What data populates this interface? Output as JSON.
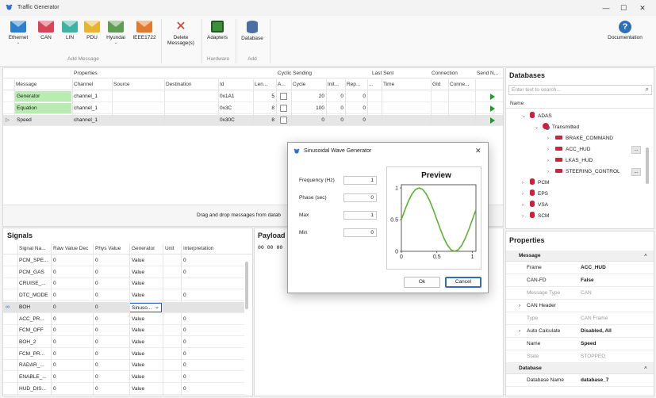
{
  "window": {
    "title": "Traffic Generator",
    "minimize": "—",
    "maximize": "☐",
    "close": "✕"
  },
  "ribbon": {
    "add_message": {
      "group_label": "Add Message",
      "buttons": [
        {
          "label": "Ethernet",
          "color": "#2f7fd1",
          "chev": "⌄"
        },
        {
          "label": "CAN",
          "color": "#d9445a",
          "chev": ""
        },
        {
          "label": "LIN",
          "color": "#3fb3a3",
          "chev": ""
        },
        {
          "label": "PDU",
          "color": "#e8b530",
          "chev": ""
        },
        {
          "label": "Hyundai",
          "color": "#5f9e52",
          "chev": "⌄"
        },
        {
          "label": "IEEE1722",
          "color": "#e07a2e",
          "chev": ""
        }
      ],
      "delete_label_1": "Delete",
      "delete_label_2": "Message(s)"
    },
    "hardware": {
      "group_label": "Hardware",
      "adapters_label": "Adapters"
    },
    "add": {
      "group_label": "Add",
      "database_label": "Database"
    },
    "documentation_label": "Documentation"
  },
  "messages_grid": {
    "group_headers": {
      "properties": "Properties",
      "cyclic": "Cyclic Sending",
      "last_sent": "Last Sent",
      "connection": "Connection",
      "send_now": "Send N..."
    },
    "columns": [
      "Message",
      "Channel",
      "Source",
      "Destination",
      "Id",
      "Len...",
      "A...",
      "Cycle",
      "Init...",
      "Rep...",
      "...",
      "Time",
      "GId",
      "Conne..."
    ],
    "rows": [
      {
        "message": "Generator",
        "channel": "channel_1",
        "id": "0x1A1",
        "len": "5",
        "cycle": "20",
        "init": "0",
        "rep": "0"
      },
      {
        "message": "Equation",
        "channel": "channel_1",
        "id": "0x3C",
        "len": "8",
        "cycle": "100",
        "init": "0",
        "rep": "0"
      },
      {
        "message": "Speed",
        "channel": "channel_1",
        "id": "0x30C",
        "len": "8",
        "cycle": "0",
        "init": "0",
        "rep": "0"
      }
    ],
    "selected_marker": "▷",
    "drag_hint": "Drag and drop messages from datab"
  },
  "signals": {
    "title": "Signals",
    "columns": [
      "Signal Na...",
      "Raw Value Dec",
      "Phys Value",
      "Generator",
      "Unit",
      "Interpretation"
    ],
    "rows": [
      {
        "name": "PCM_SPE...",
        "raw": "0",
        "phys": "0",
        "gen": "Value",
        "interp": "0"
      },
      {
        "name": "PCM_GAS",
        "raw": "0",
        "phys": "0",
        "gen": "Value",
        "interp": "0"
      },
      {
        "name": "CRUISE_...",
        "raw": "0",
        "phys": "0",
        "gen": "Value",
        "interp": ""
      },
      {
        "name": "DTC_MODE",
        "raw": "0",
        "phys": "0",
        "gen": "Value",
        "interp": "0"
      },
      {
        "name": "BOH",
        "raw": "0",
        "phys": "0",
        "gen": "Sinuso...",
        "interp": ""
      },
      {
        "name": "ACC_PR...",
        "raw": "0",
        "phys": "0",
        "gen": "Value",
        "interp": "0"
      },
      {
        "name": "FCM_OFF",
        "raw": "0",
        "phys": "0",
        "gen": "Value",
        "interp": "0"
      },
      {
        "name": "BOH_2",
        "raw": "0",
        "phys": "0",
        "gen": "Value",
        "interp": "0"
      },
      {
        "name": "FCM_PR...",
        "raw": "0",
        "phys": "0",
        "gen": "Value",
        "interp": "0"
      },
      {
        "name": "RADAR_...",
        "raw": "0",
        "phys": "0",
        "gen": "Value",
        "interp": "0"
      },
      {
        "name": "ENABLE_...",
        "raw": "0",
        "phys": "0",
        "gen": "Value",
        "interp": "0"
      },
      {
        "name": "HUD_DIS...",
        "raw": "0",
        "phys": "0",
        "gen": "Value",
        "interp": "0"
      }
    ]
  },
  "payload": {
    "title": "Payload",
    "bytes": "00  00  00"
  },
  "databases": {
    "title": "Databases",
    "search_placeholder": "Enter text to search...",
    "name_header": "Name",
    "tree": [
      {
        "label": "ADAS",
        "tri": "⌄",
        "kind": "db"
      },
      {
        "label": "Transmitted",
        "tri": "⌄",
        "kind": "tx"
      },
      {
        "label": "BRAKE_COMMAND",
        "tri": "›",
        "kind": "msg"
      },
      {
        "label": "ACC_HUD",
        "tri": "›",
        "kind": "msg"
      },
      {
        "label": "LKAS_HUD",
        "tri": "›",
        "kind": "msg"
      },
      {
        "label": "STEERING_CONTROL",
        "tri": "›",
        "kind": "msg"
      },
      {
        "label": "PCM",
        "tri": "›",
        "kind": "db"
      },
      {
        "label": "EPS",
        "tri": "›",
        "kind": "db"
      },
      {
        "label": "VSA",
        "tri": "›",
        "kind": "db"
      },
      {
        "label": "SCM",
        "tri": "›",
        "kind": "db"
      }
    ],
    "more": "..."
  },
  "properties": {
    "title": "Properties",
    "message_section": "Message",
    "frame_k": "Frame",
    "frame_v": "ACC_HUD",
    "canfd_k": "CAN-FD",
    "canfd_v": "False",
    "msgtype_k": "Message Type",
    "msgtype_v": "CAN",
    "canheader_k": "CAN Header",
    "type_k": "Type",
    "type_v": "CAN Frame",
    "autocalc_k": "Auto Calculate",
    "autocalc_v": "Disabled, All",
    "name_k": "Name",
    "name_v": "Speed",
    "state_k": "State",
    "state_v": "STOPPED",
    "database_section": "Database",
    "dbname_k": "Database Name",
    "dbname_v": "database_7"
  },
  "dialog": {
    "title": "Sinusoidal Wave Generator",
    "close": "✕",
    "fields": [
      {
        "label": "Frequency (Hz)",
        "value": "1"
      },
      {
        "label": "Phase (sec)",
        "value": "0"
      },
      {
        "label": "Max",
        "value": "1"
      },
      {
        "label": "Min",
        "value": "0"
      }
    ],
    "ok_label": "Ok",
    "cancel_label": "Cancel"
  },
  "chart_data": {
    "type": "line",
    "title": "Preview",
    "xlim": [
      0,
      1.05
    ],
    "ylim": [
      0,
      1.05
    ],
    "xticks": [
      "0",
      "0.5",
      "1"
    ],
    "yticks": [
      "0",
      "0.5",
      "1"
    ],
    "xtick_values": [
      0,
      0.5,
      1
    ],
    "ytick_values": [
      0,
      0.5,
      1
    ],
    "series": [
      {
        "color": "#5ab42e",
        "x": [
          0,
          0.05,
          0.1,
          0.15,
          0.2,
          0.25,
          0.3,
          0.35,
          0.4,
          0.45,
          0.5,
          0.55,
          0.6,
          0.65,
          0.7,
          0.75,
          0.8,
          0.85,
          0.9,
          0.95,
          1.0,
          1.05
        ],
        "y": [
          0.5,
          0.655,
          0.794,
          0.905,
          0.976,
          1.0,
          0.976,
          0.905,
          0.794,
          0.655,
          0.5,
          0.345,
          0.206,
          0.095,
          0.024,
          0.0,
          0.024,
          0.095,
          0.206,
          0.345,
          0.5,
          0.655
        ]
      }
    ],
    "grid": false,
    "legend": "none"
  }
}
